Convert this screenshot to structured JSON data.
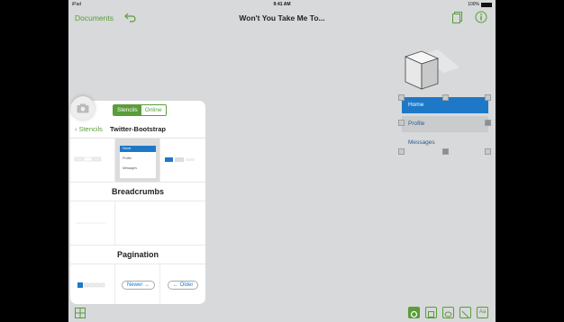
{
  "status": {
    "carrier": "iPad",
    "time": "9:41 AM",
    "battery": "100%"
  },
  "nav": {
    "documents_label": "Documents",
    "title": "Won't You Take Me To..."
  },
  "canvas": {
    "menu_items": [
      {
        "label": "Home"
      },
      {
        "label": "Profile"
      },
      {
        "label": "Messages"
      }
    ]
  },
  "popover": {
    "segments": [
      "Stencils",
      "Online"
    ],
    "back_label": "Stencils",
    "title": "Twitter-Bootstrap",
    "nav_preview": [
      "Home",
      "Profile",
      "Messages"
    ],
    "section_breadcrumbs": "Breadcrumbs",
    "section_pagination": "Pagination",
    "pager_newer": "Newer →",
    "pager_older": "← Older"
  },
  "colors": {
    "accent": "#5a9d3a",
    "active": "#1e78c8"
  }
}
